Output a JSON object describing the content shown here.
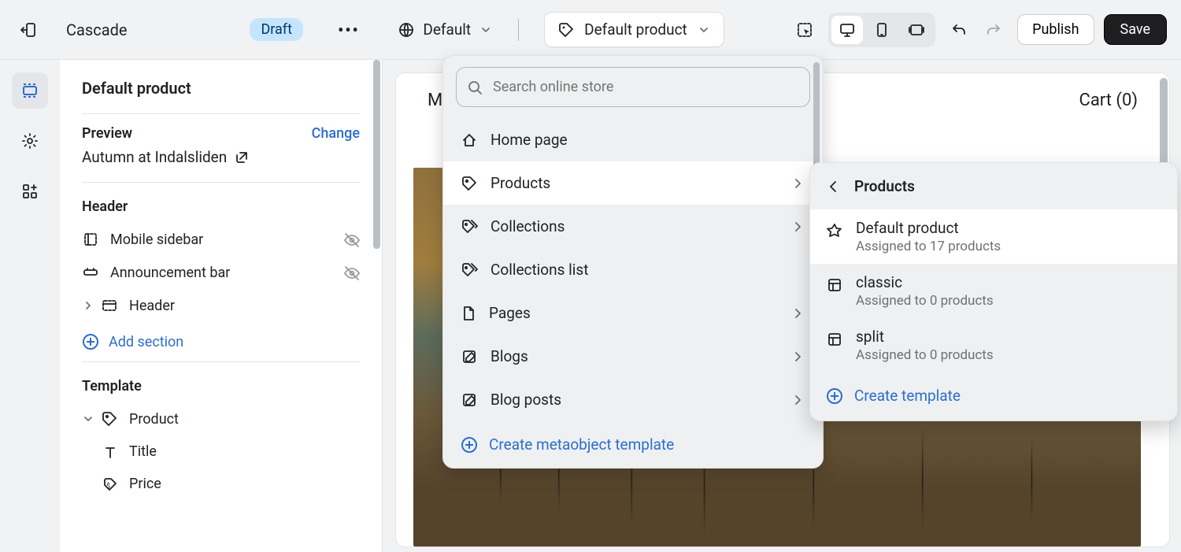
{
  "topbar": {
    "theme_name": "Cascade",
    "status_badge": "Draft",
    "locale_label": "Default",
    "template_label": "Default product",
    "publish_label": "Publish",
    "save_label": "Save"
  },
  "sidebar": {
    "title": "Default product",
    "preview_label": "Preview",
    "change_label": "Change",
    "preview_name": "Autumn at Indalsliden",
    "header_section": "Header",
    "header_items": [
      "Mobile sidebar",
      "Announcement bar",
      "Header"
    ],
    "add_section_label": "Add section",
    "template_section": "Template",
    "product_item": "Product",
    "product_children": [
      "Title",
      "Price"
    ]
  },
  "canvas": {
    "menu_partial": "Mer",
    "cart_label": "Cart (0)"
  },
  "dropdown": {
    "search_placeholder": "Search online store",
    "items": [
      {
        "label": "Home page",
        "icon": "home",
        "has_sub": false
      },
      {
        "label": "Products",
        "icon": "tag",
        "has_sub": true,
        "selected": true
      },
      {
        "label": "Collections",
        "icon": "tags",
        "has_sub": true
      },
      {
        "label": "Collections list",
        "icon": "tags",
        "has_sub": false
      },
      {
        "label": "Pages",
        "icon": "page",
        "has_sub": true
      },
      {
        "label": "Blogs",
        "icon": "blog",
        "has_sub": true
      },
      {
        "label": "Blog posts",
        "icon": "blog",
        "has_sub": true
      }
    ],
    "create_label": "Create metaobject template"
  },
  "submenu": {
    "title": "Products",
    "items": [
      {
        "name": "Default product",
        "assigned": "Assigned to 17 products",
        "icon": "star",
        "selected": true
      },
      {
        "name": "classic",
        "assigned": "Assigned to 0 products",
        "icon": "template",
        "selected": false
      },
      {
        "name": "split",
        "assigned": "Assigned to 0 products",
        "icon": "template",
        "selected": false
      }
    ],
    "create_label": "Create template"
  }
}
